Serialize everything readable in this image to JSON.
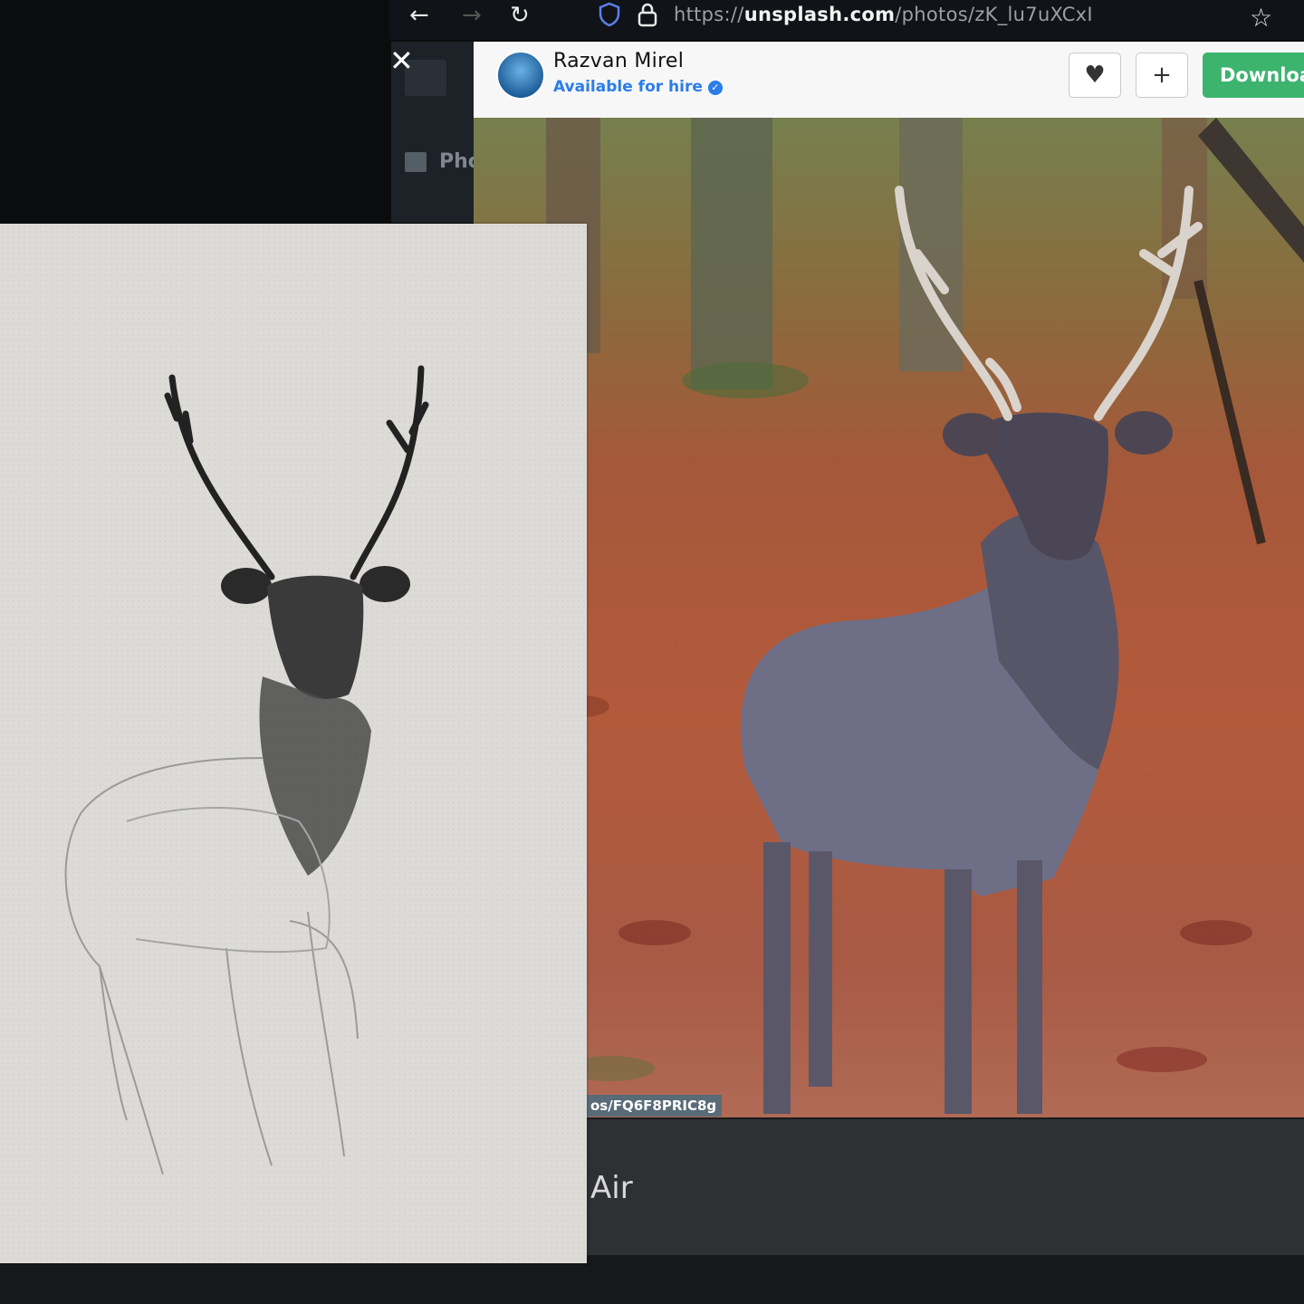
{
  "browser": {
    "url_prefix": "https://",
    "url_domain": "unsplash.com",
    "url_path": "/photos/zK_lu7uXCxI"
  },
  "sidebar": {
    "tab_partial_label": "Pho"
  },
  "header": {
    "author_name": "Razvan Mirel",
    "hire_status": "Available for hire",
    "download_label": "Download"
  },
  "photo": {
    "caption_partial": "os/FQ6F8PRIC8g"
  },
  "laptop": {
    "brand_partial": "Air"
  },
  "icons": {
    "back": "arrow-left-icon",
    "forward": "arrow-right-icon",
    "reload": "reload-icon",
    "shield": "shield-icon",
    "lock": "lock-icon",
    "star": "star-icon",
    "close": "close-icon",
    "like": "heart-icon",
    "add": "plus-icon"
  },
  "colors": {
    "download_button": "#3cb46e",
    "hire_link": "#2b7de9"
  }
}
